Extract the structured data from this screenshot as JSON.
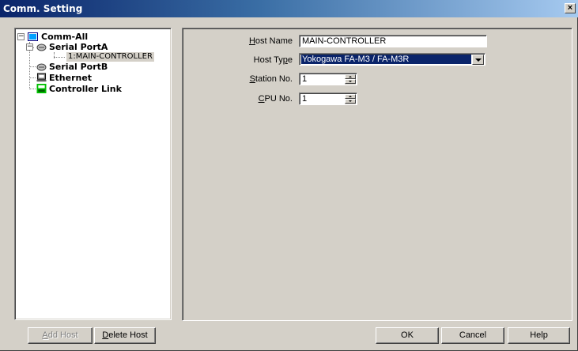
{
  "window": {
    "title": "Comm. Setting",
    "close_label": "×"
  },
  "tree": {
    "root": {
      "label": "Comm-All",
      "expander": "−"
    },
    "serial_a": {
      "label": "Serial PortA",
      "expander": "−"
    },
    "host_node": {
      "label": "1:MAIN-CONTROLLER"
    },
    "serial_b": {
      "label": "Serial PortB"
    },
    "ethernet": {
      "label": "Ethernet"
    },
    "controller_link": {
      "label": "Controller Link"
    }
  },
  "form": {
    "host_name": {
      "label_pre": "",
      "label_key": "H",
      "label_post": "ost Name",
      "value": "MAIN-CONTROLLER"
    },
    "host_type": {
      "label_pre": "Host Ty",
      "label_key": "p",
      "label_post": "e",
      "value": "Yokogawa FA-M3 / FA-M3R"
    },
    "station_no": {
      "label_pre": "",
      "label_key": "S",
      "label_post": "tation No.",
      "value": "1"
    },
    "cpu_no": {
      "label_pre": "",
      "label_key": "C",
      "label_post": "PU No.",
      "value": "1"
    }
  },
  "buttons": {
    "add_host": {
      "pre": "",
      "key": "A",
      "post": "dd Host"
    },
    "delete_host": {
      "pre": "",
      "key": "D",
      "post": "elete Host"
    },
    "ok": "OK",
    "cancel": "Cancel",
    "help": "Help"
  },
  "colors": {
    "face": "#d4d0c8",
    "title_start": "#0a246a",
    "title_end": "#a6caf0",
    "selection": "#0a246a"
  }
}
